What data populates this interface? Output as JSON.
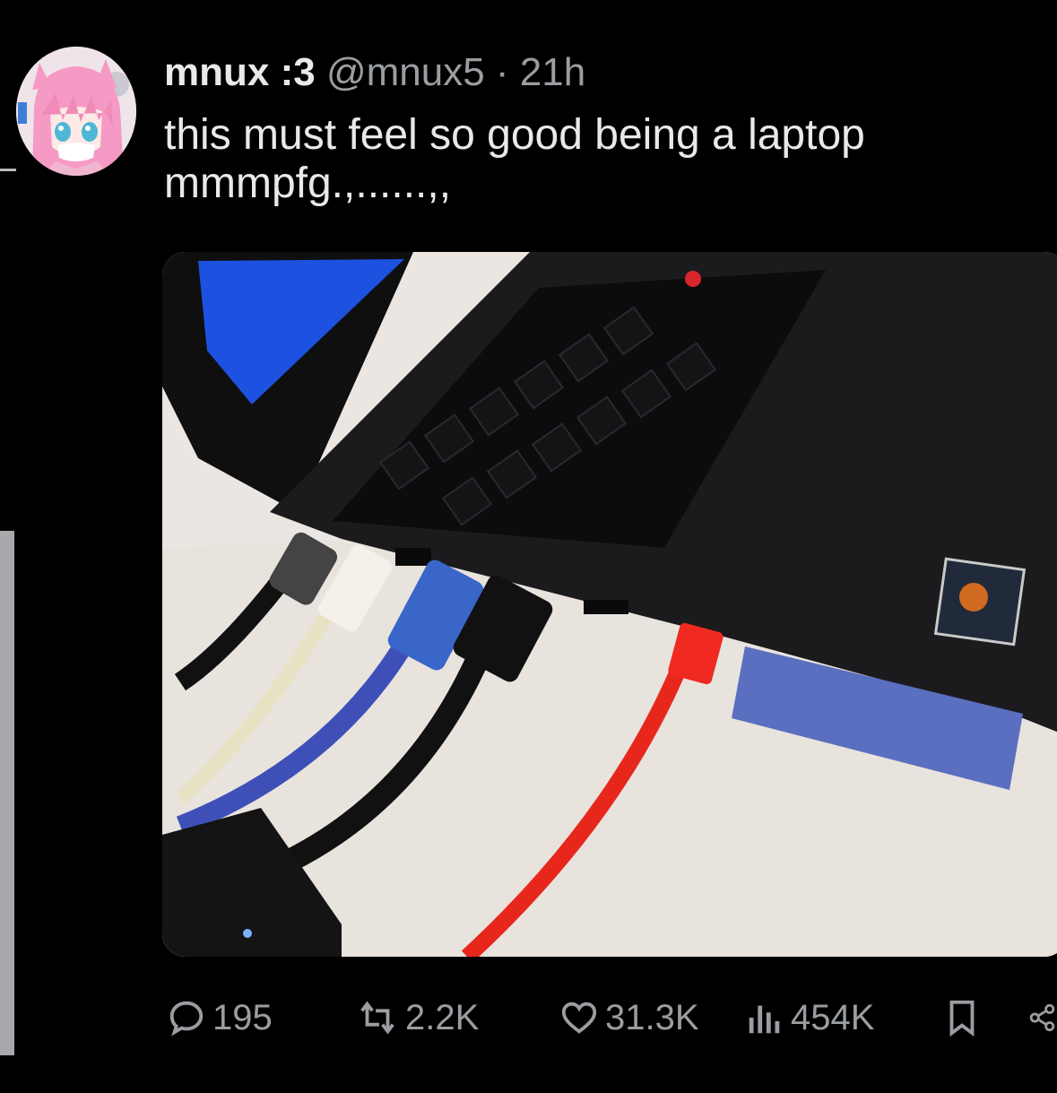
{
  "tweet": {
    "display_name": "mnux :3",
    "handle": "@mnux5",
    "separator": "·",
    "time": "21h",
    "text_line_1": "this must feel so good being a laptop",
    "text_line_2": "mmmpfg.,......,,"
  },
  "media": {
    "icons": [
      "laptop-photo"
    ]
  },
  "actions": {
    "replies": "195",
    "reposts": "2.2K",
    "likes": "31.3K",
    "views": "454K"
  },
  "icons": {
    "reply": "reply-icon",
    "repost": "repost-icon",
    "like": "heart-icon",
    "views": "views-chart-icon",
    "bookmark": "bookmark-icon",
    "share": "share-icon"
  },
  "colors": {
    "background": "#000000",
    "text": "#e7e9ea",
    "muted": "#9a9da1"
  }
}
